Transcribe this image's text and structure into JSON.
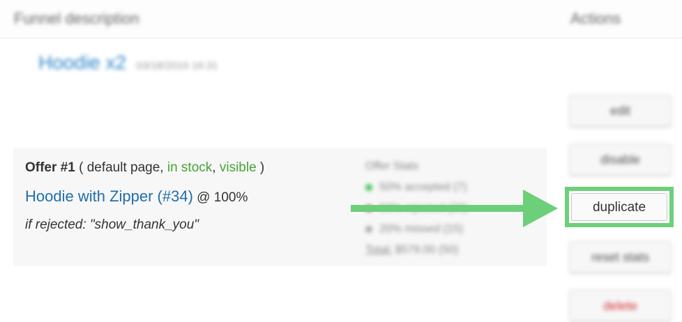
{
  "table": {
    "col_funnel_description": "Funnel description",
    "col_actions": "Actions"
  },
  "funnel": {
    "name": "Hoodie x2",
    "date": "03/18/2019 16:31"
  },
  "offer": {
    "label": "Offer #1",
    "paren_open": " ( default page, ",
    "stock_status": "in stock",
    "comma": ", ",
    "visibility": "visible",
    "paren_close": " )",
    "product_link": "Hoodie with Zipper (#34)",
    "percentage": " @ 100%",
    "rejected_text": "if rejected: \"show_thank_you\""
  },
  "stats": {
    "title": "Offer Stats",
    "accepted": "50% accepted (7)",
    "rejected": "50% rejected (28)",
    "missed": "20% missed (15)",
    "total_label": "Total:",
    "total_value": "$579.00 (50)"
  },
  "actions": {
    "edit": "edit",
    "disable": "disable",
    "duplicate": "duplicate",
    "reset_stats": "reset stats",
    "delete": "delete"
  },
  "colors": {
    "accent_green": "#6dcf7a",
    "link_blue": "#1f6eaa",
    "status_green": "#46a335",
    "delete_red": "#d63638"
  }
}
